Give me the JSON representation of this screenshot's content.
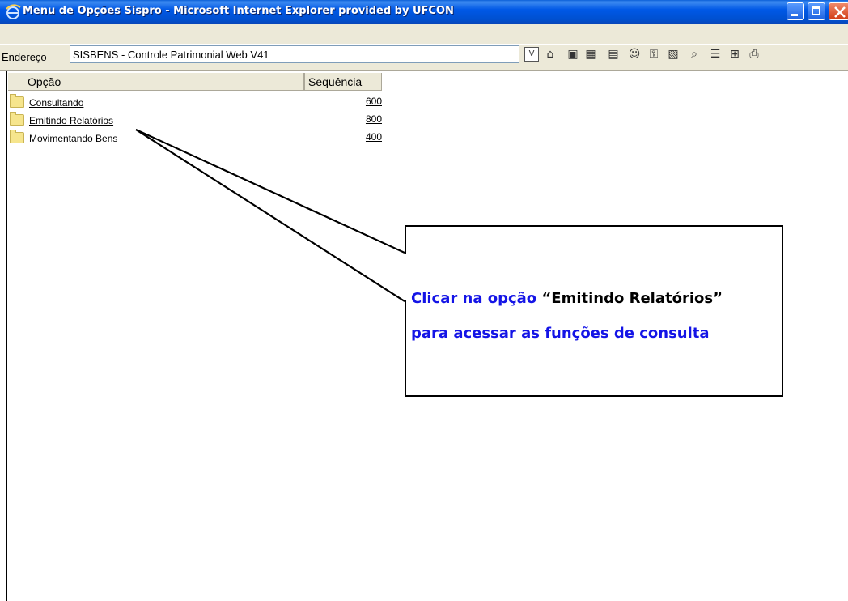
{
  "window": {
    "title": "Menu de Opções Sispro - Microsoft Internet Explorer provided by UFCON"
  },
  "address": {
    "label": "Endereço",
    "value": "SISBENS - Controle Patrimonial Web V41"
  },
  "toolbar": {
    "first_button_label": "V",
    "icons": [
      "up-folder-icon",
      "view-icon",
      "grid-icon",
      "list-icon",
      "user-icon",
      "key-icon",
      "properties-icon",
      "search-icon",
      "tree-icon",
      "tree-add-icon",
      "print-icon"
    ]
  },
  "table": {
    "headers": {
      "option": "Opção",
      "sequence": "Sequência"
    },
    "rows": [
      {
        "label": "Consultando",
        "sequence": "600"
      },
      {
        "label": "Emitindo Relatórios",
        "sequence": "800"
      },
      {
        "label": "Movimentando Bens",
        "sequence": "400"
      }
    ]
  },
  "callout": {
    "line1_part1": "Clicar na opção ",
    "line1_part2": "“Emitindo Relatórios”",
    "line2": "para acessar as funções de consulta"
  },
  "colors": {
    "titlebar": "#0058e6",
    "callout_blue": "#1414e6",
    "folder": "#f6e58d"
  }
}
